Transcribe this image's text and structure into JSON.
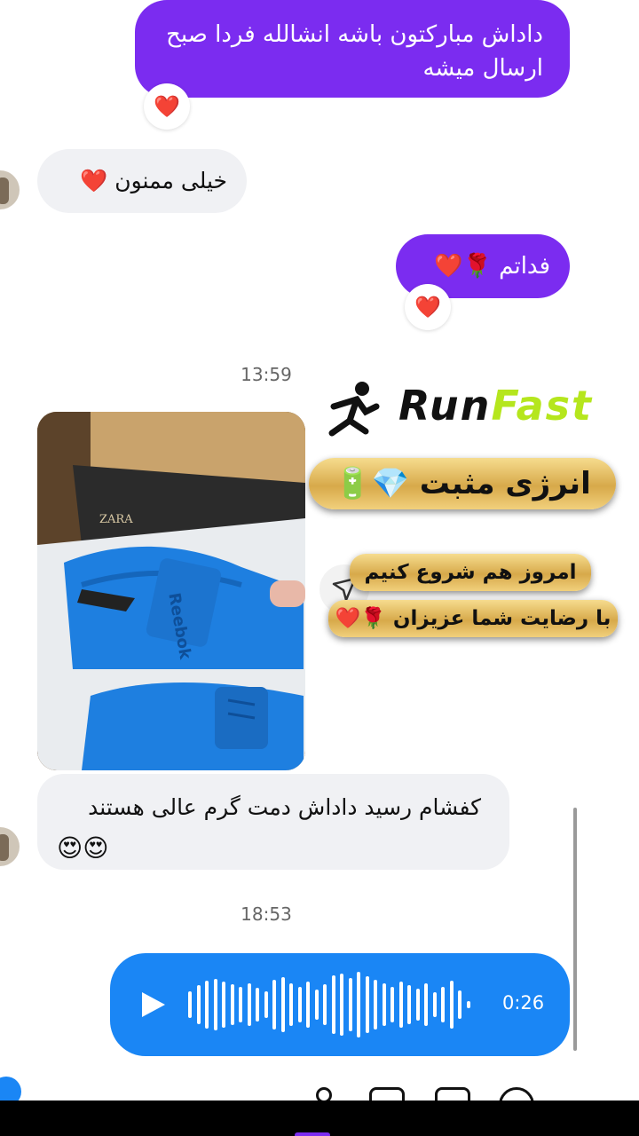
{
  "messages": {
    "out1": {
      "text_line1": "داداش مبارکتون باشه انشالله فردا صبح",
      "text_line2": "ارسال میشه",
      "reaction": "❤️"
    },
    "in1": {
      "text": "خیلی ممنون",
      "emoji": "❤️"
    },
    "out2": {
      "text": "فداتم",
      "emoji": "🌹❤️",
      "reaction": "❤️"
    },
    "time1": "13:59",
    "post": {
      "brand": {
        "run": "Run",
        "fast": "Fast"
      },
      "pill1": "انرژی مثبت",
      "pill1_icons": "💎🔋",
      "pill2": "امروز هم شروع کنیم",
      "pill3": "با رضایت شما عزیزان",
      "pill3_icons": "🌹❤️",
      "photo_labels": {
        "box_top": "ZARA",
        "shoe_brand": "Reebok"
      }
    },
    "in2": {
      "text": "کفشام رسید داداش دمت گرم عالی هستند",
      "emoji": "😍😍"
    },
    "time2": "18:53",
    "voice": {
      "duration": "0:26"
    }
  },
  "colors": {
    "outgoing": "#7b2cf0",
    "incoming": "#f0f1f4",
    "voice": "#1a86f5",
    "brand_green": "#b5e61d"
  }
}
